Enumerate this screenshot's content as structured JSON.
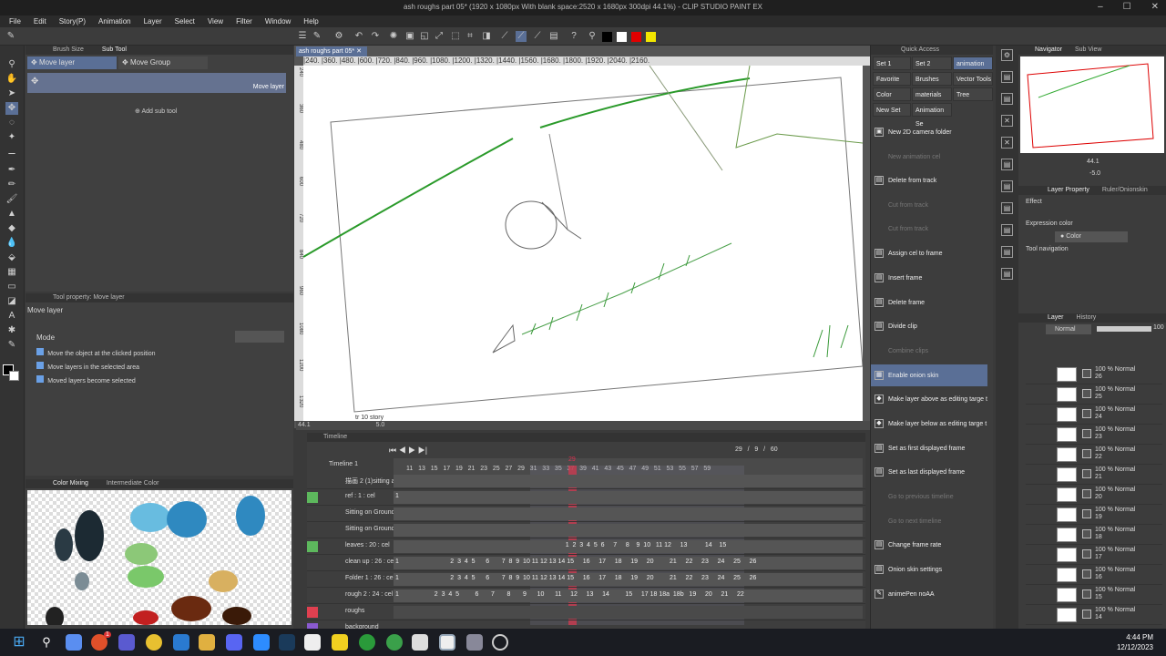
{
  "window": {
    "title": "ash roughs part 05* (1920 x 1080px With blank space:2520 x 1680px 300dpi 44.1%) - CLIP STUDIO PAINT EX"
  },
  "menu": [
    "File",
    "Edit",
    "Story(P)",
    "Animation",
    "Layer",
    "Select",
    "View",
    "Filter",
    "Window",
    "Help"
  ],
  "colors": {
    "black": "#000000",
    "white": "#ffffff",
    "red": "#e00000",
    "yellow": "#f2e600"
  },
  "subtool": {
    "tabs": [
      "Brush Size",
      "Sub Tool"
    ],
    "items": [
      "Move layer",
      "Move Group"
    ],
    "selected_label": "Move layer",
    "add_label": "Add sub tool"
  },
  "tool_property": {
    "header": "Tool property: Move layer",
    "name": "Move layer",
    "mode_label": "Mode",
    "options": [
      "Move the object at the clicked position",
      "Move layers in the selected area",
      "Moved layers become selected"
    ]
  },
  "color_mixing": {
    "tabs": [
      "Color Mixing",
      "Intermediate Color"
    ]
  },
  "canvas": {
    "tab": "ash roughs part 05*",
    "ruler": "|240.  |360.  |480.  |600.  |720.  |840.  |960.  |1080. |1200. |1320. |1440. |1560. |1680. |1800. |1920. |2040. |2160.",
    "ruler_v": [
      "240",
      "360",
      "480",
      "600",
      "720",
      "840",
      "960",
      "1080",
      "1200",
      "1320"
    ],
    "zoom": "44.1",
    "angle": "5.0",
    "frame_label": "tr 10 story"
  },
  "timeline": {
    "header": "Timeline",
    "name": "Timeline 1",
    "current_frame": "29",
    "counter": "29   /   9   /   60",
    "ruler": "11   13   15   17   19   21   23   25   27   29   31   33   35   37   39   41   43   45   47   49   51   53   55   57   59",
    "rows": [
      {
        "name": "描画 2 (1)sitting ar",
        "nums": ""
      },
      {
        "name": "ref : 1 : cel",
        "nums": "1"
      },
      {
        "name": "Sitting on Ground Cu",
        "nums": ""
      },
      {
        "name": "Sitting on Ground",
        "nums": ""
      },
      {
        "name": "leaves : 20 : cel",
        "nums": "                                                                                                1  2  3  4  5  6     7     8    9  10   11 12     13          14    15"
      },
      {
        "name": "clean up : 26 : cel",
        "nums": "1                             2  3  4  5      6       7  8  9  10 11 12 13 14 15     16     17     18     19     20         21     22     23     24     25     26"
      },
      {
        "name": "Folder 1 : 26 : cel",
        "nums": "1                             2  3  4  5      6       7  8  9  10 11 12 13 14 15     16     17     18     19     20         21     22     23     24     25     26"
      },
      {
        "name": "rough 2 : 24 : cel",
        "nums": "1                    2  3  4  5         6       7       8       9      10      11     12     13     14         15     17 18 18a  18b   19     20     21     22"
      },
      {
        "name": "roughs",
        "nums": ""
      },
      {
        "name": "background",
        "nums": ""
      }
    ]
  },
  "quick_access": {
    "header": "Quick Access",
    "tabs": [
      [
        "Set 1",
        "Set 2",
        "animation set"
      ],
      [
        "Favorite Brus",
        "Brushes",
        "Vector Tools"
      ],
      [
        "Color",
        "materials",
        "Tree"
      ],
      [
        "New Set",
        "Animation Se"
      ]
    ],
    "items": [
      {
        "label": "New 2D camera folder",
        "enabled": true
      },
      {
        "label": "New animation cel",
        "enabled": false
      },
      {
        "label": "Delete from track",
        "enabled": true
      },
      {
        "label": "Cut from track",
        "enabled": false
      },
      {
        "label": "Cut from track",
        "enabled": false
      },
      {
        "label": "Assign cel to frame",
        "enabled": true
      },
      {
        "label": "Insert frame",
        "enabled": true
      },
      {
        "label": "Delete frame",
        "enabled": true
      },
      {
        "label": "Divide clip",
        "enabled": true
      },
      {
        "label": "Combine clips",
        "enabled": false
      },
      {
        "label": "Enable onion skin",
        "enabled": true
      },
      {
        "label": "Make layer above as editing targe t",
        "enabled": true
      },
      {
        "label": "Make layer below as editing targe t",
        "enabled": true
      },
      {
        "label": "Set as first displayed frame",
        "enabled": true
      },
      {
        "label": "Set as last displayed frame",
        "enabled": true
      },
      {
        "label": "Go to previous timeline",
        "enabled": false
      },
      {
        "label": "Go to next timeline",
        "enabled": false
      },
      {
        "label": "Change frame rate",
        "enabled": true
      },
      {
        "label": "Onion skin settings",
        "enabled": true
      },
      {
        "label": "animePen noAA",
        "enabled": true
      }
    ]
  },
  "navigator": {
    "tabs": [
      "Navigator",
      "Sub View"
    ],
    "zoom": "44.1",
    "angle": "-5.0"
  },
  "layer_property": {
    "tabs": [
      "Layer Property",
      "Ruler/Onionskin"
    ],
    "effect": "Effect",
    "expression_color": "Expression color",
    "color_value": "Color",
    "tool_navigation": "Tool navigation"
  },
  "layers": {
    "tabs": [
      "Layer",
      "History"
    ],
    "blend": "Normal",
    "opacity": "100",
    "rows": [
      [
        "100 % Normal",
        "26"
      ],
      [
        "100 % Normal",
        "25"
      ],
      [
        "100 % Normal",
        "24"
      ],
      [
        "100 % Normal",
        "23"
      ],
      [
        "100 % Normal",
        "22"
      ],
      [
        "100 % Normal",
        "21"
      ],
      [
        "100 % Normal",
        "20"
      ],
      [
        "100 % Normal",
        "19"
      ],
      [
        "100 % Normal",
        "18"
      ],
      [
        "100 % Normal",
        "17"
      ],
      [
        "100 % Normal",
        "16"
      ],
      [
        "100 % Normal",
        "15"
      ],
      [
        "100 % Normal",
        "14"
      ]
    ]
  },
  "taskbar": {
    "time": "4:44 PM",
    "date": "12/12/2023",
    "badge": "1"
  }
}
